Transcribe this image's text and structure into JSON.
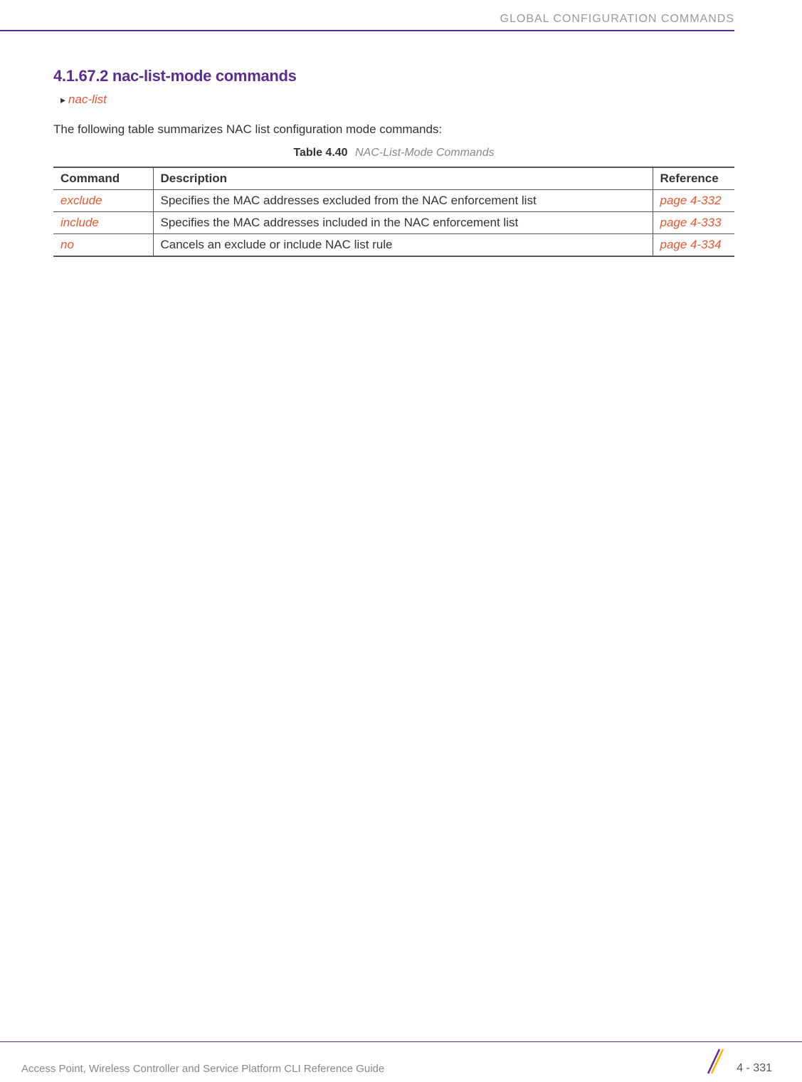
{
  "header": {
    "title": "GLOBAL CONFIGURATION COMMANDS"
  },
  "section": {
    "heading": "4.1.67.2 nac-list-mode commands",
    "breadcrumb_link": "nac-list",
    "intro": "The following table summarizes NAC list configuration mode commands:",
    "table_caption_label": "Table 4.40",
    "table_caption_title": "NAC-List-Mode Commands"
  },
  "table": {
    "headers": {
      "col1": "Command",
      "col2": "Description",
      "col3": "Reference"
    },
    "rows": [
      {
        "command": "exclude",
        "description": "Specifies the MAC addresses excluded from the NAC enforcement list",
        "reference": "page 4-332"
      },
      {
        "command": "include",
        "description": "Specifies the MAC addresses included in the NAC enforcement list",
        "reference": "page 4-333"
      },
      {
        "command": "no",
        "description": "Cancels an exclude or include NAC list rule",
        "reference": "page 4-334"
      }
    ]
  },
  "footer": {
    "guide_title": "Access Point, Wireless Controller and Service Platform CLI Reference Guide",
    "page_number": "4 - 331"
  }
}
